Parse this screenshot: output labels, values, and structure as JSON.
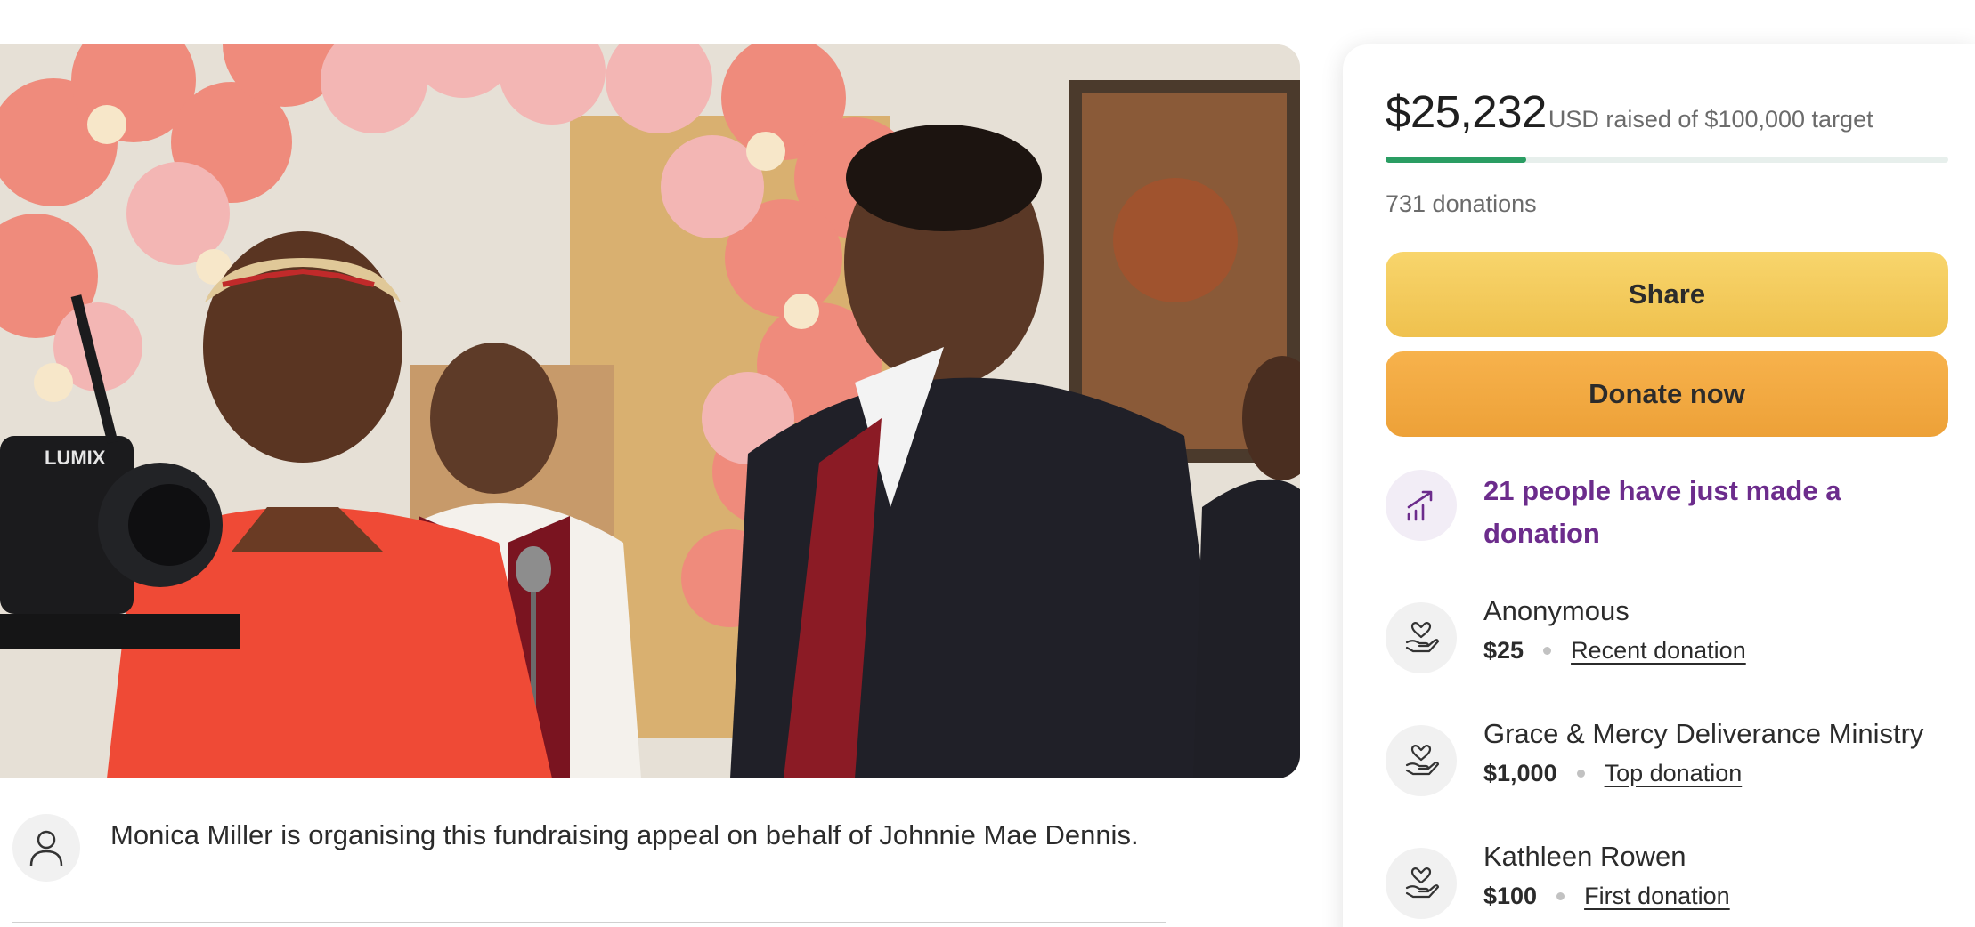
{
  "organiser": {
    "text": "Monica Miller is organising this fundraising appeal on behalf of Johnnie Mae Dennis."
  },
  "campaign_photo": {
    "scene_text": "LUMIX"
  },
  "stats": {
    "raised_amount": "$25,232",
    "raised_suffix": "USD raised of $100,000 target",
    "progress_fraction": 0.25,
    "donations_label": "731 donations"
  },
  "actions": {
    "share_label": "Share",
    "donate_label": "Donate now"
  },
  "trending": {
    "label": "21 people have just made a donation"
  },
  "donors": [
    {
      "name": "Anonymous",
      "amount": "$25",
      "tag": "Recent donation"
    },
    {
      "name": "Grace & Mercy Deliverance Ministry",
      "amount": "$1,000",
      "tag": "Top donation"
    },
    {
      "name": "Kathleen Rowen",
      "amount": "$100",
      "tag": "First donation"
    }
  ],
  "colors": {
    "progress": "#2a9d63",
    "share_button": "#f8d56c",
    "donate_button": "#f7b24c",
    "trending_text": "#6c2c8c"
  },
  "icons": {
    "organiser": "person-icon",
    "trending": "trending-up-icon",
    "donor": "heart-hand-icon"
  }
}
